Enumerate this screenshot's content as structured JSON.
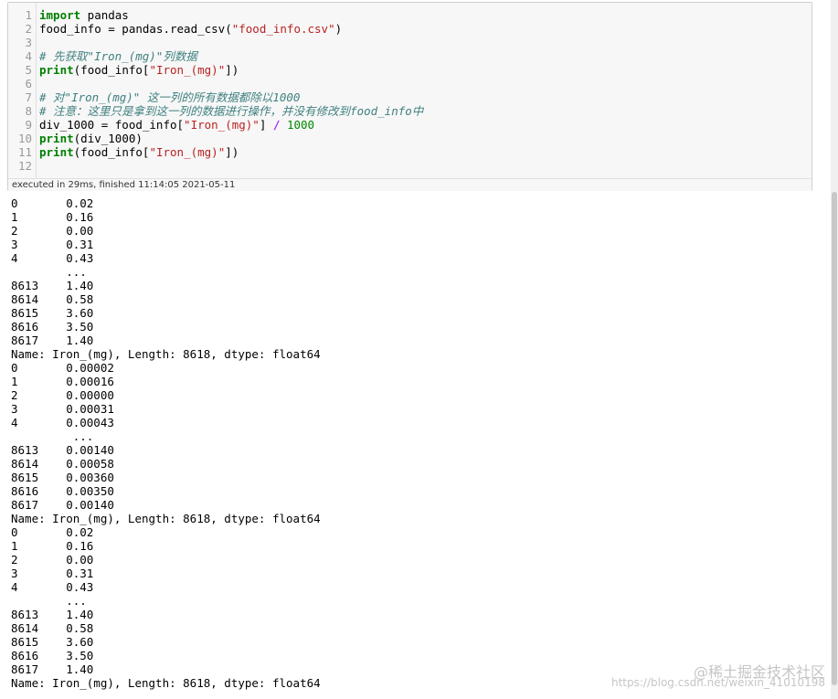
{
  "cell": {
    "line_numbers": [
      "1",
      "2",
      "3",
      "4",
      "5",
      "6",
      "7",
      "8",
      "9",
      "10",
      "11",
      "12"
    ],
    "code": {
      "l1_kw": "import",
      "l1_rest": " pandas",
      "l2_a": "food_info = pandas.read_csv(",
      "l2_str": "\"food_info.csv\"",
      "l2_b": ")",
      "l4_comment": "# 先获取\"Iron_(mg)\"列数据",
      "l5_kw": "print",
      "l5_a": "(food_info[",
      "l5_str": "\"Iron_(mg)\"",
      "l5_b": "])",
      "l7_comment": "# 对\"Iron_(mg)\" 这一列的所有数据都除以1000",
      "l8_comment": "# 注意：这里只是拿到这一列的数据进行操作，并没有修改到food_info中",
      "l9_a": "div_1000 = food_info[",
      "l9_str": "\"Iron_(mg)\"",
      "l9_b": "] ",
      "l9_op": "/",
      "l9_sp": " ",
      "l9_num": "1000",
      "l10_kw": "print",
      "l10_rest": "(div_1000)",
      "l11_kw": "print",
      "l11_a": "(food_info[",
      "l11_str": "\"Iron_(mg)\"",
      "l11_b": "])"
    },
    "exec_status": "executed in 29ms, finished 11:14:05 2021-05-11"
  },
  "output_lines": [
    "0       0.02",
    "1       0.16",
    "2       0.00",
    "3       0.31",
    "4       0.43",
    "        ...",
    "8613    1.40",
    "8614    0.58",
    "8615    3.60",
    "8616    3.50",
    "8617    1.40",
    "Name: Iron_(mg), Length: 8618, dtype: float64",
    "0       0.00002",
    "1       0.00016",
    "2       0.00000",
    "3       0.00031",
    "4       0.00043",
    "         ...",
    "8613    0.00140",
    "8614    0.00058",
    "8615    0.00360",
    "8616    0.00350",
    "8617    0.00140",
    "Name: Iron_(mg), Length: 8618, dtype: float64",
    "0       0.02",
    "1       0.16",
    "2       0.00",
    "3       0.31",
    "4       0.43",
    "        ...",
    "8613    1.40",
    "8614    0.58",
    "8615    3.60",
    "8616    3.50",
    "8617    1.40",
    "Name: Iron_(mg), Length: 8618, dtype: float64"
  ],
  "watermark": {
    "line1": "@稀土掘金技术社区",
    "line2": "https://blog.csdn.net/weixin_41010198"
  },
  "colors": {
    "keyword": "#008000",
    "string": "#ba2121",
    "comment": "#408080",
    "operator": "#aa22ff",
    "number": "#008800"
  }
}
